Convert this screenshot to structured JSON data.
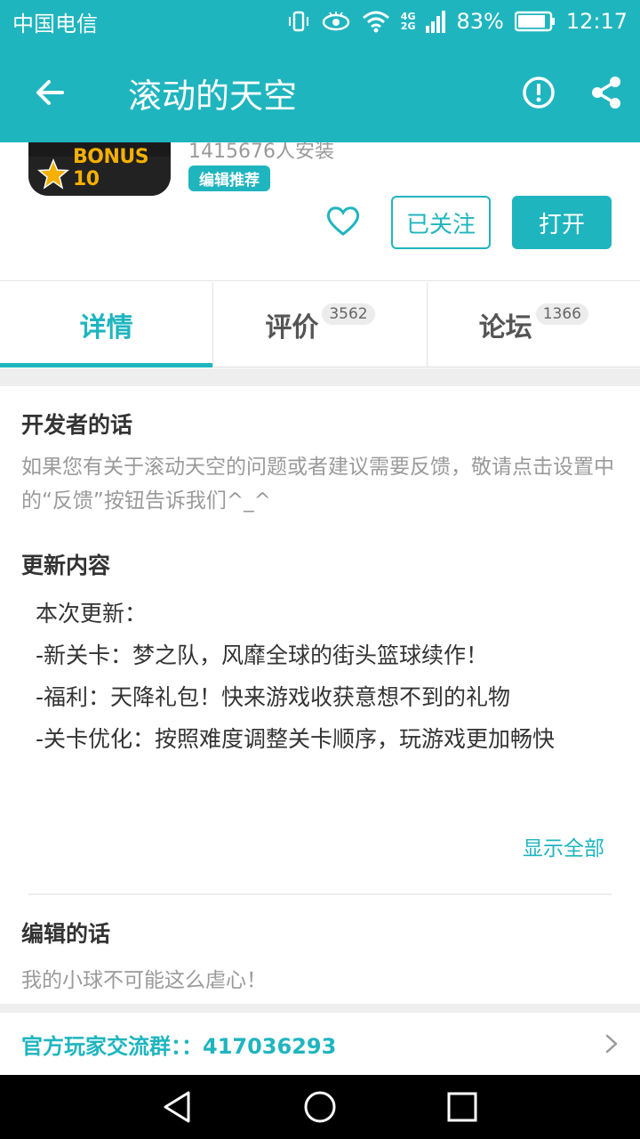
{
  "status_bar": {
    "carrier": "中国电信",
    "network_top": "4G",
    "network_bottom": "2G",
    "battery": "83%",
    "time": "12:17"
  },
  "app_bar": {
    "title": "滚动的天空",
    "back_icon": "arrow-left-icon",
    "report_icon": "alert-circle-icon",
    "share_icon": "share-icon"
  },
  "app_header": {
    "icon_text": "BONUS 10",
    "installs": "1415676人安装",
    "badge": "编辑推荐",
    "follow_label": "已关注",
    "open_label": "打开"
  },
  "tabs": [
    {
      "label": "详情",
      "count": ""
    },
    {
      "label": "评价",
      "count": "3562"
    },
    {
      "label": "论坛",
      "count": "1366"
    }
  ],
  "developer": {
    "title": "开发者的话",
    "text": "如果您有关于滚动天空的问题或者建议需要反馈，敬请点击设置中的“反馈”按钮告诉我们^_^"
  },
  "update": {
    "title": "更新内容",
    "lines": [
      "本次更新：",
      "-新关卡：梦之队，风靡全球的街头篮球续作！",
      "-福利：天降礼包！快来游戏收获意想不到的礼物",
      "-关卡优化：按照难度调整关卡顺序，玩游戏更加畅快"
    ],
    "show_all": "显示全部"
  },
  "editor": {
    "title": "编辑的话",
    "text": "我的小球不可能这么虐心！"
  },
  "group": {
    "label": "官方玩家交流群：：417036293"
  },
  "colors": {
    "accent": "#1fb5bf",
    "text": "#333333",
    "muted": "#9a9a9a"
  }
}
